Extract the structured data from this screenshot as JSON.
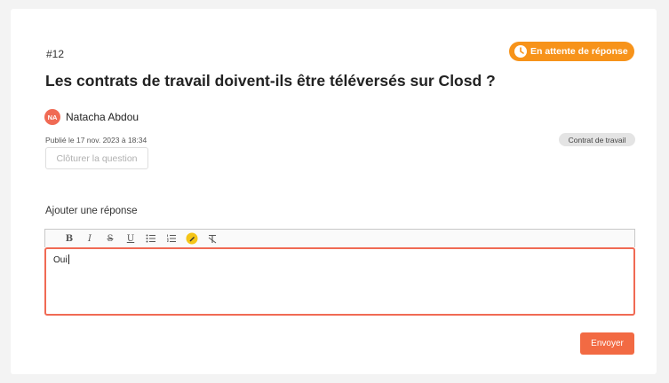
{
  "question": {
    "number": "#12",
    "title": "Les contrats de travail doivent-ils être téléversés sur Closd ?",
    "status": "En attente de réponse",
    "status_icon": "clock-icon",
    "author_initials": "NA",
    "author_name": "Natacha Abdou",
    "published": "Publié le 17 nov. 2023 à 18:34",
    "tag": "Contrat de travail",
    "close_label": "Clôturer la question"
  },
  "reply": {
    "label": "Ajouter une réponse",
    "toolbar": [
      {
        "name": "bold-icon",
        "glyph": "B"
      },
      {
        "name": "italic-icon",
        "glyph": "I"
      },
      {
        "name": "strikethrough-icon",
        "glyph": "S"
      },
      {
        "name": "underline-icon",
        "glyph": "U"
      },
      {
        "name": "bullet-list-icon",
        "glyph": "☰"
      },
      {
        "name": "numbered-list-icon",
        "glyph": "☷"
      },
      {
        "name": "highlight-icon",
        "glyph": "✎"
      },
      {
        "name": "clear-format-icon",
        "glyph": "T̸"
      }
    ],
    "text": "Oui",
    "send_label": "Envoyer"
  },
  "colors": {
    "accent": "#f26a43",
    "status": "#f7931a",
    "highlight": "#f5c518"
  }
}
